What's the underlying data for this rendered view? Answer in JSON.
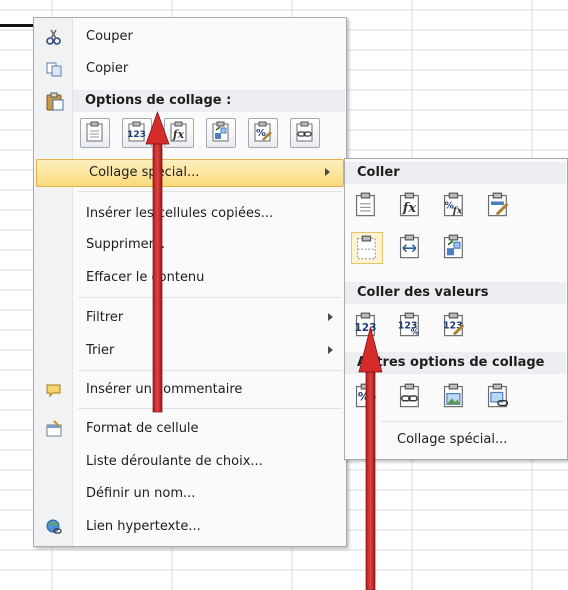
{
  "main_menu": {
    "cut": "Couper",
    "copy": "Copier",
    "paste_options_header": "Options de collage :",
    "paste_special": "Collage spécial...",
    "insert_copied_cells": "Insérer les cellules copiées...",
    "delete": "Supprimer...",
    "clear_contents": "Effacer le contenu",
    "filter": "Filtrer",
    "sort": "Trier",
    "insert_comment": "Insérer un commentaire",
    "format_cells": "Format de cellule",
    "pick_from_list": "Liste déroulante de choix...",
    "define_name": "Définir un nom...",
    "hyperlink": "Lien hypertexte..."
  },
  "paste_buttons": [
    "paste-icon",
    "paste-values-icon",
    "paste-formulas-icon",
    "paste-transpose-icon",
    "paste-formatting-icon",
    "paste-link-icon"
  ],
  "submenu": {
    "paste_header": "Coller",
    "values_header": "Coller des valeurs",
    "other_header": "Autres options de collage",
    "paste_special": "Collage spécial..."
  },
  "colors": {
    "highlight": "#fbd97c",
    "annotation_arrow": "#d52b2b"
  }
}
